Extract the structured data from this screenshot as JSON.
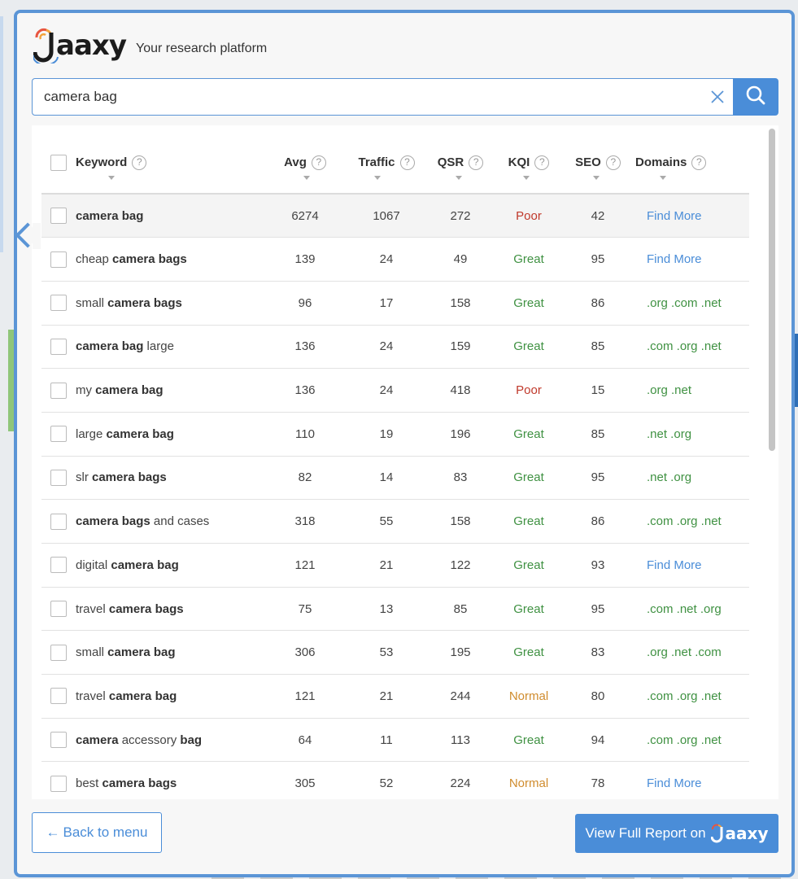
{
  "app": {
    "logo_text": "aaxy",
    "tagline": "Your research platform"
  },
  "search": {
    "value": "camera bag",
    "clear_icon": "close-icon",
    "search_icon": "search-icon"
  },
  "table": {
    "columns": [
      "Keyword",
      "Avg",
      "Traffic",
      "QSR",
      "KQI",
      "SEO",
      "Domains"
    ],
    "help_glyph": "?",
    "rows": [
      {
        "kw": [
          [
            "camera bag",
            true
          ]
        ],
        "avg": "6274",
        "traffic": "1067",
        "qsr": "272",
        "kqi": "Poor",
        "seo": "42",
        "domains": "Find More"
      },
      {
        "kw": [
          [
            "cheap ",
            false
          ],
          [
            "camera bags",
            true
          ]
        ],
        "avg": "139",
        "traffic": "24",
        "qsr": "49",
        "kqi": "Great",
        "seo": "95",
        "domains": "Find More"
      },
      {
        "kw": [
          [
            "small ",
            false
          ],
          [
            "camera bags",
            true
          ]
        ],
        "avg": "96",
        "traffic": "17",
        "qsr": "158",
        "kqi": "Great",
        "seo": "86",
        "domains": ".org .com .net"
      },
      {
        "kw": [
          [
            "camera bag",
            true
          ],
          [
            " large",
            false
          ]
        ],
        "avg": "136",
        "traffic": "24",
        "qsr": "159",
        "kqi": "Great",
        "seo": "85",
        "domains": ".com .org .net"
      },
      {
        "kw": [
          [
            "my ",
            false
          ],
          [
            "camera bag",
            true
          ]
        ],
        "avg": "136",
        "traffic": "24",
        "qsr": "418",
        "kqi": "Poor",
        "seo": "15",
        "domains": ".org .net"
      },
      {
        "kw": [
          [
            "large ",
            false
          ],
          [
            "camera bag",
            true
          ]
        ],
        "avg": "110",
        "traffic": "19",
        "qsr": "196",
        "kqi": "Great",
        "seo": "85",
        "domains": ".net .org"
      },
      {
        "kw": [
          [
            "slr ",
            false
          ],
          [
            "camera bags",
            true
          ]
        ],
        "avg": "82",
        "traffic": "14",
        "qsr": "83",
        "kqi": "Great",
        "seo": "95",
        "domains": ".net .org"
      },
      {
        "kw": [
          [
            "camera bags",
            true
          ],
          [
            " and cases",
            false
          ]
        ],
        "avg": "318",
        "traffic": "55",
        "qsr": "158",
        "kqi": "Great",
        "seo": "86",
        "domains": ".com .org .net"
      },
      {
        "kw": [
          [
            "digital ",
            false
          ],
          [
            "camera bag",
            true
          ]
        ],
        "avg": "121",
        "traffic": "21",
        "qsr": "122",
        "kqi": "Great",
        "seo": "93",
        "domains": "Find More"
      },
      {
        "kw": [
          [
            "travel ",
            false
          ],
          [
            "camera bags",
            true
          ]
        ],
        "avg": "75",
        "traffic": "13",
        "qsr": "85",
        "kqi": "Great",
        "seo": "95",
        "domains": ".com .net .org"
      },
      {
        "kw": [
          [
            "small ",
            false
          ],
          [
            "camera bag",
            true
          ]
        ],
        "avg": "306",
        "traffic": "53",
        "qsr": "195",
        "kqi": "Great",
        "seo": "83",
        "domains": ".org .net .com"
      },
      {
        "kw": [
          [
            "travel ",
            false
          ],
          [
            "camera bag",
            true
          ]
        ],
        "avg": "121",
        "traffic": "21",
        "qsr": "244",
        "kqi": "Normal",
        "seo": "80",
        "domains": ".com .org .net"
      },
      {
        "kw": [
          [
            "camera",
            true
          ],
          [
            " accessory ",
            false
          ],
          [
            "bag",
            true
          ]
        ],
        "avg": "64",
        "traffic": "11",
        "qsr": "113",
        "kqi": "Great",
        "seo": "94",
        "domains": ".com .org .net"
      },
      {
        "kw": [
          [
            "best ",
            false
          ],
          [
            "camera bags",
            true
          ]
        ],
        "avg": "305",
        "traffic": "52",
        "qsr": "224",
        "kqi": "Normal",
        "seo": "78",
        "domains": "Find More"
      }
    ]
  },
  "footer": {
    "back_label": "Back to menu",
    "back_arrow": "←",
    "report_label": "View Full Report on",
    "report_logo_text": "aaxy"
  },
  "colors": {
    "accent": "#4a8dd8",
    "border": "#5b95d6",
    "great": "#3f9142",
    "poor": "#c0392b",
    "normal": "#d08c2e"
  }
}
